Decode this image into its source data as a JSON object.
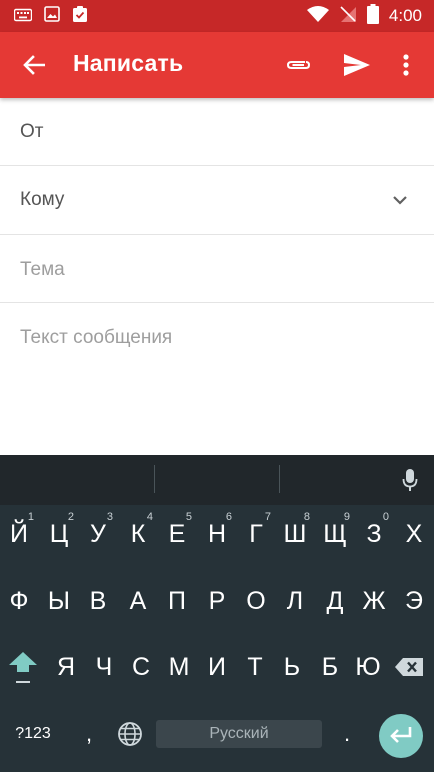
{
  "status_bar": {
    "time": "4:00",
    "icons": [
      "keyboard-icon",
      "image-icon",
      "clipboard-check-icon",
      "wifi-icon",
      "no-sim-icon",
      "battery-icon"
    ]
  },
  "app_bar": {
    "title": "Написать",
    "icons": [
      "back-arrow-icon",
      "attach-icon",
      "send-icon",
      "more-vert-icon"
    ]
  },
  "compose": {
    "from_label": "От",
    "to_label": "Кому",
    "subject_placeholder": "Тема",
    "body_placeholder": "Текст сообщения"
  },
  "keyboard": {
    "row1": [
      {
        "char": "Й",
        "hint": "1"
      },
      {
        "char": "Ц",
        "hint": "2"
      },
      {
        "char": "У",
        "hint": "3"
      },
      {
        "char": "К",
        "hint": "4"
      },
      {
        "char": "Е",
        "hint": "5"
      },
      {
        "char": "Н",
        "hint": "6"
      },
      {
        "char": "Г",
        "hint": "7"
      },
      {
        "char": "Ш",
        "hint": "8"
      },
      {
        "char": "Щ",
        "hint": "9"
      },
      {
        "char": "З",
        "hint": "0"
      },
      {
        "char": "Х",
        "hint": ""
      }
    ],
    "row2": [
      "Ф",
      "Ы",
      "В",
      "А",
      "П",
      "Р",
      "О",
      "Л",
      "Д",
      "Ж",
      "Э"
    ],
    "row3": [
      "Я",
      "Ч",
      "С",
      "М",
      "И",
      "Т",
      "Ь",
      "Б",
      "Ю"
    ],
    "num_key": "?123",
    "comma": ",",
    "space_label": "Русский",
    "period": ".",
    "colors": {
      "accent": "#80cbc4",
      "shift": "#80cbc4",
      "background": "#263238"
    }
  },
  "colors": {
    "app_bar": "#e53935",
    "status_bar": "#c62828"
  }
}
